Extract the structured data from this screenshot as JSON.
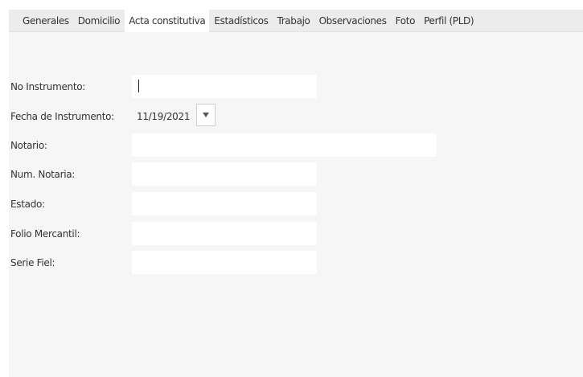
{
  "tabs": [
    {
      "label": "Generales",
      "active": false
    },
    {
      "label": "Domicilio",
      "active": false
    },
    {
      "label": "Acta constitutiva",
      "active": true
    },
    {
      "label": "Estadísticos",
      "active": false
    },
    {
      "label": "Trabajo",
      "active": false
    },
    {
      "label": "Observaciones",
      "active": false
    },
    {
      "label": "Foto",
      "active": false
    },
    {
      "label": "Perfil (PLD)",
      "active": false
    }
  ],
  "form": {
    "no_instrumento": {
      "label": "No Instrumento:",
      "value": ""
    },
    "fecha_instrumento": {
      "label": "Fecha de Instrumento:",
      "value": "11/19/2021"
    },
    "notario": {
      "label": "Notario:",
      "value": ""
    },
    "num_notaria": {
      "label": "Num. Notaria:",
      "value": ""
    },
    "estado": {
      "label": "Estado:",
      "value": ""
    },
    "folio_mercantil": {
      "label": "Folio Mercantil:",
      "value": ""
    },
    "serie_fiel": {
      "label": "Serie Fiel:",
      "value": ""
    }
  },
  "icons": {
    "date_dropdown": "triangle-down-icon"
  },
  "colors": {
    "panel_bg": "#f6f6f6",
    "tabbar_bg": "#ececec",
    "active_tab_bg": "#ffffff",
    "text": "#333333"
  }
}
